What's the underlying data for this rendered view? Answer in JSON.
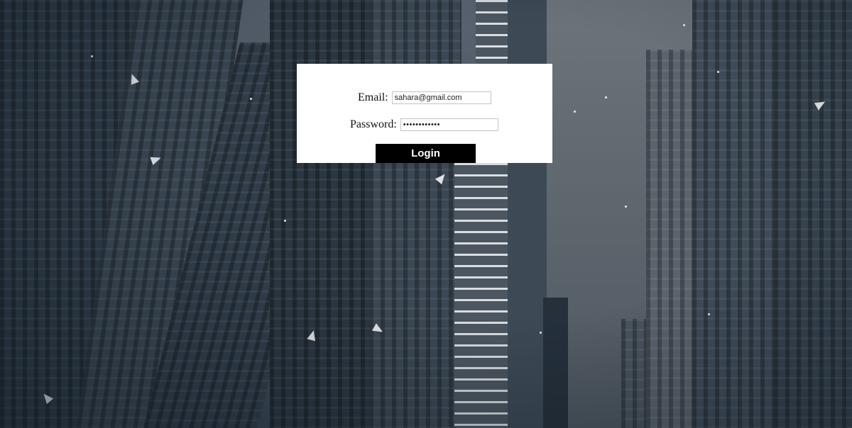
{
  "login": {
    "email_label": "Email:",
    "email_value": "sahara@gmail.com",
    "password_label": "Password:",
    "password_value": "••••••••••••",
    "login_button": "Login"
  },
  "colors": {
    "card_background": "#ffffff",
    "button_background": "#000000",
    "button_text": "#ffffff",
    "page_background": "#2c3a47"
  }
}
